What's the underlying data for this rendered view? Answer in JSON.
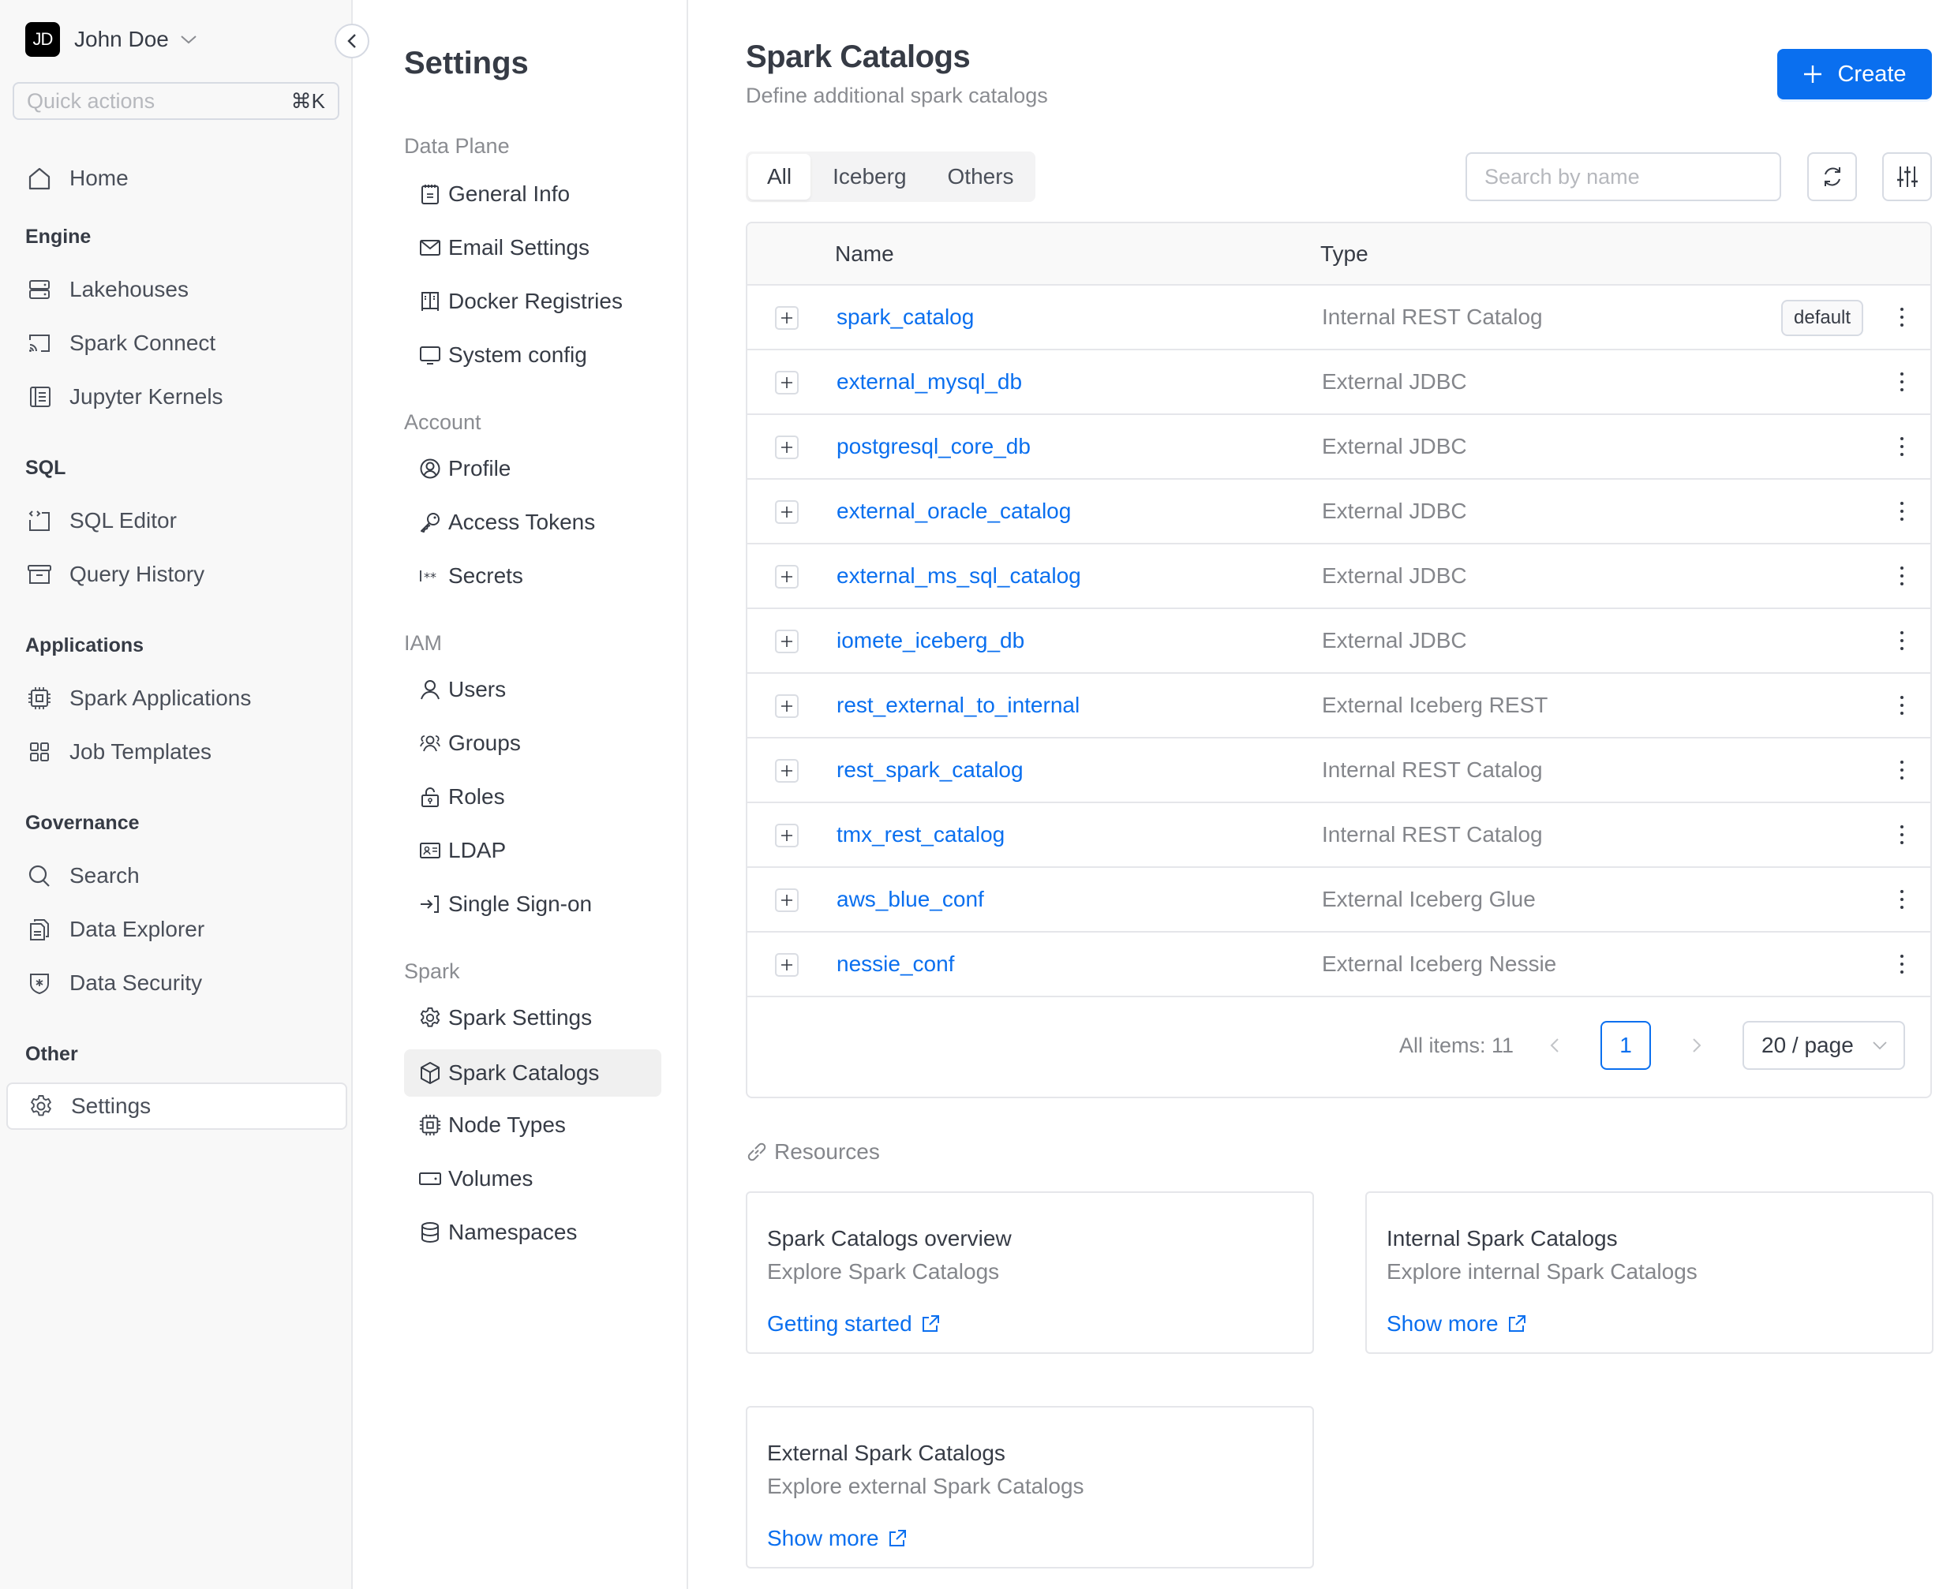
{
  "user": {
    "initials": "JD",
    "name": "John Doe"
  },
  "quick_actions": {
    "placeholder": "Quick actions",
    "shortcut": "⌘K"
  },
  "sidebar": {
    "home": {
      "label": "Home",
      "icon": "home-icon"
    },
    "sections": [
      {
        "title": "Engine",
        "items": [
          {
            "label": "Lakehouses",
            "icon": "server-icon"
          },
          {
            "label": "Spark Connect",
            "icon": "cast-icon"
          },
          {
            "label": "Jupyter Kernels",
            "icon": "notebook-icon"
          }
        ]
      },
      {
        "title": "SQL",
        "items": [
          {
            "label": "SQL Editor",
            "icon": "code-icon"
          },
          {
            "label": "Query History",
            "icon": "archive-icon"
          }
        ]
      },
      {
        "title": "Applications",
        "items": [
          {
            "label": "Spark Applications",
            "icon": "chip-icon"
          },
          {
            "label": "Job Templates",
            "icon": "grid-icon"
          }
        ]
      },
      {
        "title": "Governance",
        "items": [
          {
            "label": "Search",
            "icon": "search-icon"
          },
          {
            "label": "Data Explorer",
            "icon": "files-icon"
          },
          {
            "label": "Data Security",
            "icon": "shield-icon"
          }
        ]
      },
      {
        "title": "Other",
        "items": [
          {
            "label": "Settings",
            "icon": "gear-icon",
            "active": true
          }
        ]
      }
    ]
  },
  "settings_nav": {
    "title": "Settings",
    "sections": [
      {
        "title": "Data Plane",
        "items": [
          {
            "label": "General Info",
            "icon": "notepad-icon"
          },
          {
            "label": "Email Settings",
            "icon": "mail-icon"
          },
          {
            "label": "Docker Registries",
            "icon": "registry-icon"
          },
          {
            "label": "System config",
            "icon": "monitor-icon"
          }
        ]
      },
      {
        "title": "Account",
        "items": [
          {
            "label": "Profile",
            "icon": "user-circle-icon"
          },
          {
            "label": "Access Tokens",
            "icon": "key-icon"
          },
          {
            "label": "Secrets",
            "icon": "password-icon"
          }
        ]
      },
      {
        "title": "IAM",
        "items": [
          {
            "label": "Users",
            "icon": "user-icon"
          },
          {
            "label": "Groups",
            "icon": "users-icon"
          },
          {
            "label": "Roles",
            "icon": "lock-icon"
          },
          {
            "label": "LDAP",
            "icon": "id-card-icon"
          },
          {
            "label": "Single Sign-on",
            "icon": "login-icon"
          }
        ]
      },
      {
        "title": "Spark",
        "items": [
          {
            "label": "Spark Settings",
            "icon": "gear-icon"
          },
          {
            "label": "Spark Catalogs",
            "icon": "cube-icon",
            "active": true
          },
          {
            "label": "Node Types",
            "icon": "chip-icon"
          },
          {
            "label": "Volumes",
            "icon": "drive-icon"
          },
          {
            "label": "Namespaces",
            "icon": "database-icon"
          }
        ]
      }
    ]
  },
  "main": {
    "title": "Spark Catalogs",
    "subtitle": "Define additional spark catalogs",
    "create_label": "Create",
    "tabs": [
      {
        "label": "All",
        "active": true
      },
      {
        "label": "Iceberg"
      },
      {
        "label": "Others"
      }
    ],
    "search_placeholder": "Search by name",
    "table": {
      "columns": [
        "Name",
        "Type"
      ],
      "rows": [
        {
          "name": "spark_catalog",
          "type": "Internal REST Catalog",
          "badge": "default"
        },
        {
          "name": "external_mysql_db",
          "type": "External JDBC"
        },
        {
          "name": "postgresql_core_db",
          "type": "External JDBC"
        },
        {
          "name": "external_oracle_catalog",
          "type": "External JDBC"
        },
        {
          "name": "external_ms_sql_catalog",
          "type": "External JDBC"
        },
        {
          "name": "iomete_iceberg_db",
          "type": "External JDBC"
        },
        {
          "name": "rest_external_to_internal",
          "type": "External Iceberg REST"
        },
        {
          "name": "rest_spark_catalog",
          "type": "Internal REST Catalog"
        },
        {
          "name": "tmx_rest_catalog",
          "type": "Internal REST Catalog"
        },
        {
          "name": "aws_blue_conf",
          "type": "External Iceberg Glue"
        },
        {
          "name": "nessie_conf",
          "type": "External Iceberg Nessie"
        }
      ]
    },
    "pagination": {
      "all_items": "All items: 11",
      "current_page": "1",
      "page_size": "20 / page"
    },
    "resources": {
      "title": "Resources",
      "cards": [
        {
          "title": "Spark Catalogs overview",
          "desc": "Explore Spark Catalogs",
          "link": "Getting started"
        },
        {
          "title": "Internal Spark Catalogs",
          "desc": "Explore internal Spark Catalogs",
          "link": "Show more"
        },
        {
          "title": "External Spark Catalogs",
          "desc": "Explore external Spark Catalogs",
          "link": "Show more"
        }
      ]
    }
  },
  "colors": {
    "accent": "#0a6fef",
    "text": "#363b45",
    "muted": "#84868b",
    "sidebar_bg": "#f8f8f8"
  }
}
